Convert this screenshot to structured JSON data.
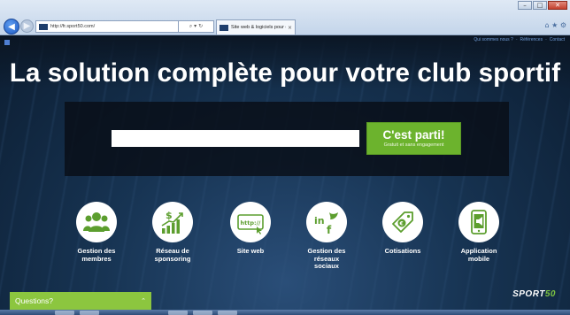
{
  "browser": {
    "url": "http://fr.sport50.com/",
    "search_glyphs": "⌕ ▾ ↻",
    "tab_title": "Site web & logiciels pour cl...",
    "tab_close": "×",
    "window_controls": {
      "minimize": "–",
      "maximize": "□",
      "close": "✕"
    },
    "toolbar_icons": "⌂ ★ ⚙"
  },
  "page": {
    "top_links": [
      "Qui sommes nous ?",
      "Références",
      "Contact"
    ],
    "headline": "La solution complète pour votre club sportif",
    "signup": {
      "input_value": "",
      "input_placeholder": "",
      "button_label": "C'est parti!",
      "button_sublabel": "Gratuit et sans engagement"
    },
    "features": [
      {
        "label": "Gestion des\nmembres",
        "icon": "members-icon"
      },
      {
        "label": "Réseau de\nsponsoring",
        "icon": "sponsoring-icon"
      },
      {
        "label": "Site web",
        "icon": "website-icon"
      },
      {
        "label": "Gestion des\nréseaux\nsociaux",
        "icon": "social-icon"
      },
      {
        "label": "Cotisations",
        "icon": "price-tag-icon"
      },
      {
        "label": "Application\nmobile",
        "icon": "mobile-app-icon"
      }
    ],
    "brand_prefix": "SPORT",
    "brand_suffix": "50",
    "chat": {
      "label": "Questions?",
      "chevron": "⌃"
    }
  },
  "colors": {
    "accent_green": "#6cb32d",
    "chat_green": "#8cc63f",
    "icon_green": "#5c9e2e",
    "background_navy": "#173453"
  }
}
